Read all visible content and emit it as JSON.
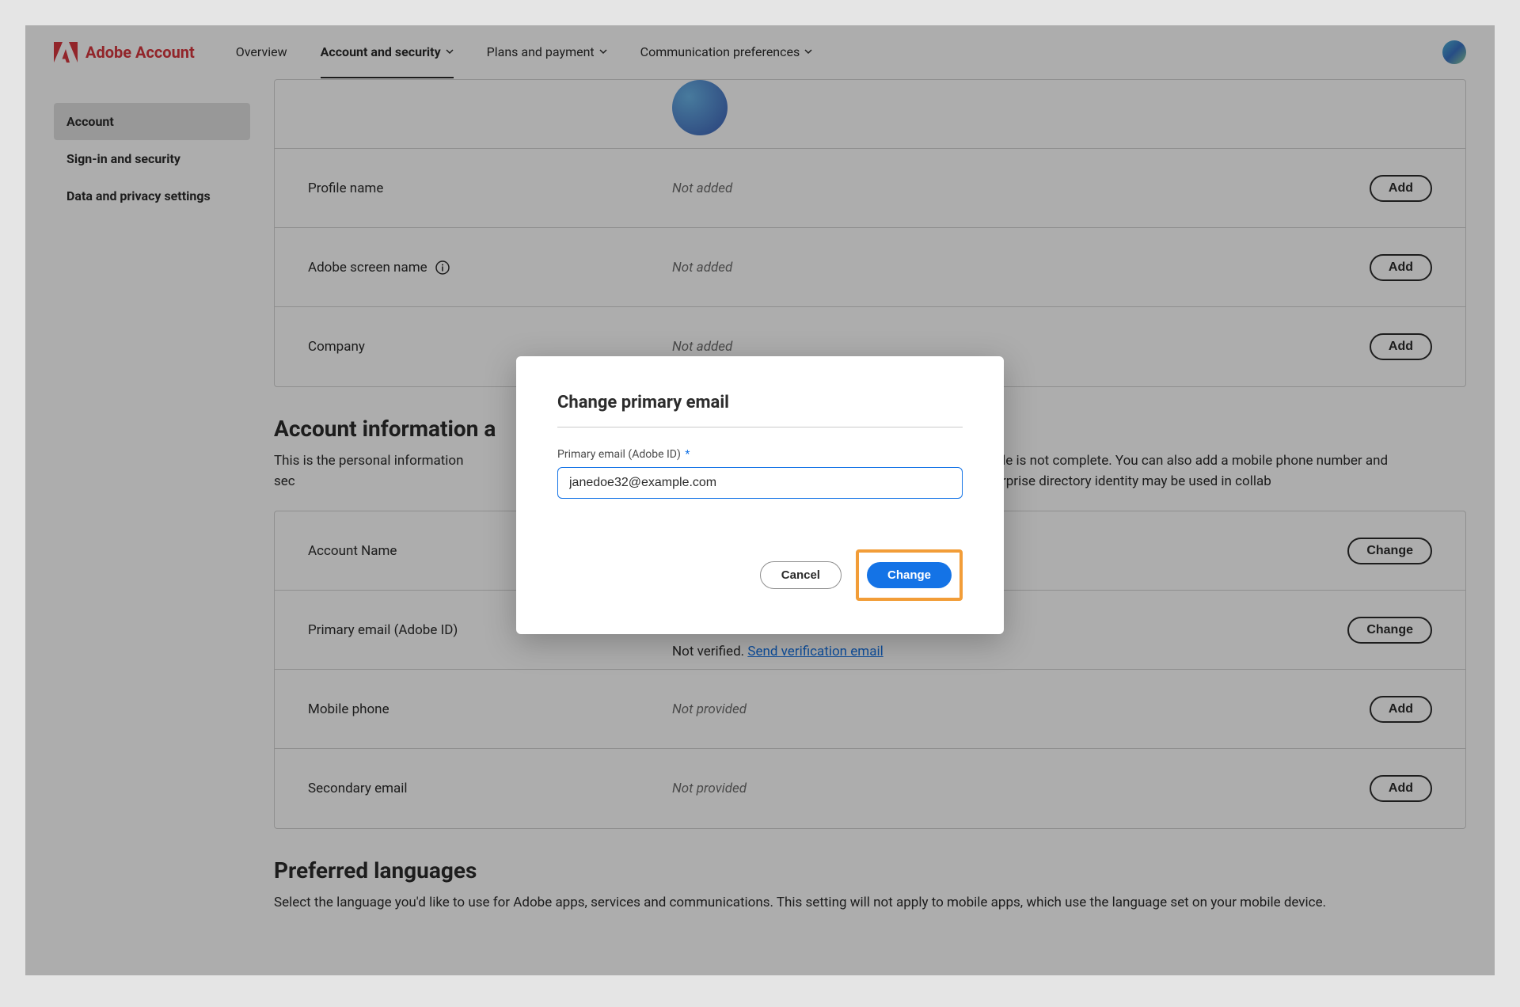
{
  "header": {
    "product": "Adobe Account",
    "nav": {
      "overview": "Overview",
      "account_security": "Account and security",
      "plans_payment": "Plans and payment",
      "comm_prefs": "Communication preferences"
    }
  },
  "sidenav": {
    "account": "Account",
    "signin_security": "Sign-in and security",
    "data_privacy": "Data and privacy settings"
  },
  "profile_panel": {
    "profile_name": {
      "label": "Profile name",
      "value": "Not added",
      "action": "Add"
    },
    "screen_name": {
      "label": "Adobe screen name",
      "value": "Not added",
      "action": "Add"
    },
    "company": {
      "label": "Company",
      "value": "Not added",
      "action": "Add"
    }
  },
  "account_info": {
    "title_partial": "Account information a",
    "desc_line1": "This is the personal information",
    "desc_line1b": "ns if your public profile is not complete. You can also add a",
    "desc_line2": "mobile phone number and sec",
    "desc_line2b": "rt of an enterprise organization, your enterprise directory",
    "desc_line3": "identity may be used in collab"
  },
  "account_panel": {
    "account_name": {
      "label": "Account Name",
      "action": "Change"
    },
    "primary_email": {
      "label": "Primary email (Adobe ID)",
      "not_verified": "Not verified.",
      "send_link": "Send verification email",
      "action": "Change"
    },
    "mobile_phone": {
      "label": "Mobile phone",
      "value": "Not provided",
      "action": "Add"
    },
    "secondary_email": {
      "label": "Secondary email",
      "value": "Not provided",
      "action": "Add"
    }
  },
  "languages": {
    "title": "Preferred languages",
    "desc": "Select the language you'd like to use for Adobe apps, services and communications. This setting will not apply to mobile apps, which use the language set on your mobile device."
  },
  "modal": {
    "title": "Change primary email",
    "field_label": "Primary email (Adobe ID)",
    "field_value": "janedoe32@example.com",
    "cancel": "Cancel",
    "change": "Change"
  }
}
